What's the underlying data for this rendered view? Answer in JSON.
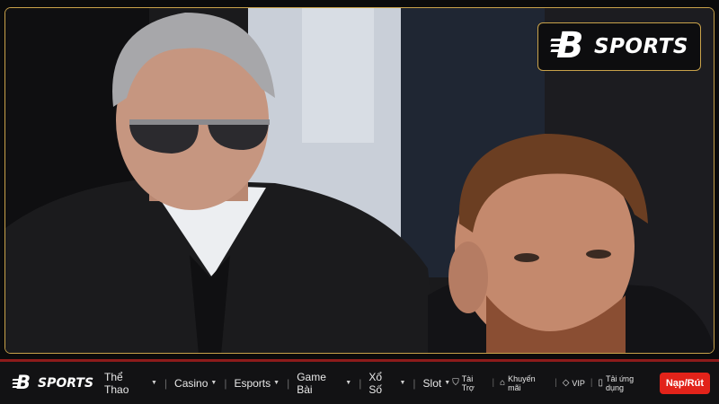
{
  "colors": {
    "gold": "#c9a24a",
    "nav_bg": "#121214",
    "nav_border": "#8e1b1b",
    "cta_bg": "#e2231a"
  },
  "badge": {
    "brand_mark": "B",
    "brand_text": "SPORTS"
  },
  "nav": {
    "logo_mark": "B",
    "logo_text": "SPORTS",
    "menu": [
      {
        "label": "Thể Thao",
        "icon": "chevron-down-icon"
      },
      {
        "label": "Casino",
        "icon": "chevron-down-icon"
      },
      {
        "label": "Esports",
        "icon": "chevron-down-icon"
      },
      {
        "label": "Game Bài",
        "icon": "chevron-down-icon"
      },
      {
        "label": "Xổ Số",
        "icon": "chevron-down-icon"
      },
      {
        "label": "Slot",
        "icon": "chevron-down-icon"
      }
    ],
    "links": [
      {
        "label": "Tài Trợ",
        "icon": "shield-icon"
      },
      {
        "label": "Khuyến mãi",
        "icon": "tag-icon"
      },
      {
        "label": "VIP",
        "icon": "diamond-icon"
      },
      {
        "label": "Tải ứng dụng",
        "icon": "phone-icon"
      }
    ],
    "cta_label": "Nạp/Rút"
  }
}
